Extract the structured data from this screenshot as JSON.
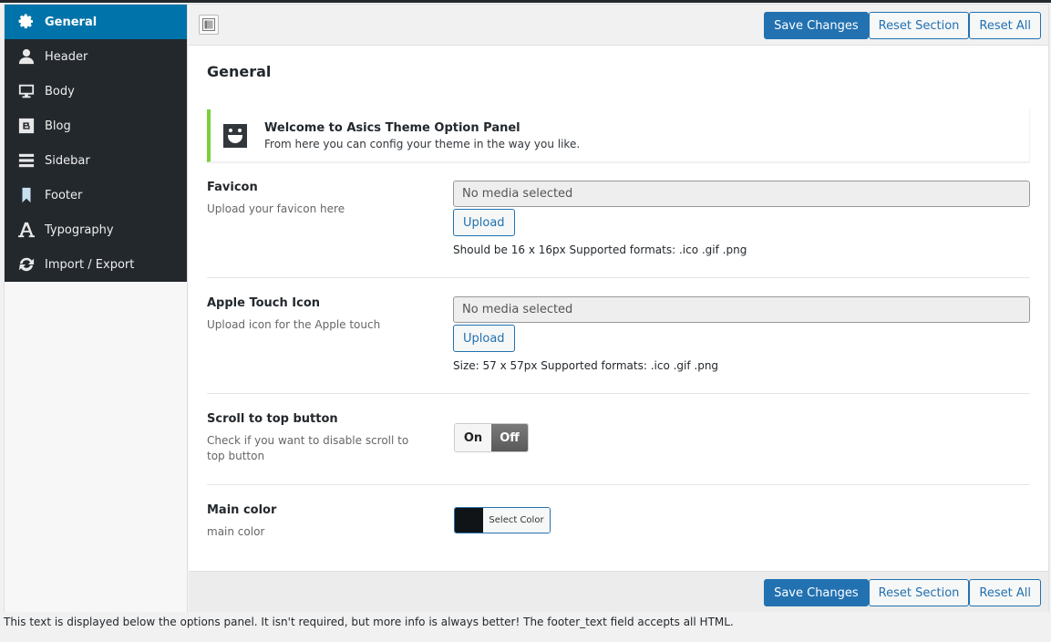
{
  "sidebar": {
    "items": [
      {
        "label": "General",
        "icon": "gear-icon",
        "active": true
      },
      {
        "label": "Header",
        "icon": "user-icon"
      },
      {
        "label": "Body",
        "icon": "monitor-icon"
      },
      {
        "label": "Blog",
        "icon": "blogger-icon"
      },
      {
        "label": "Sidebar",
        "icon": "menu-bars-icon"
      },
      {
        "label": "Footer",
        "icon": "bookmark-icon"
      },
      {
        "label": "Typography",
        "icon": "font-icon"
      },
      {
        "label": "Import / Export",
        "icon": "refresh-icon"
      }
    ]
  },
  "toolbar": {
    "expand_icon": "expand-panel-icon",
    "save_label": "Save Changes",
    "reset_section_label": "Reset Section",
    "reset_all_label": "Reset All"
  },
  "section": {
    "title": "General",
    "notice": {
      "icon": "smiley-icon",
      "title": "Welcome to Asics Theme Option Panel",
      "text": "From here you can config your theme in the way you like.",
      "accent": "#7ad03a"
    },
    "fields": {
      "favicon": {
        "title": "Favicon",
        "desc": "Upload your favicon here",
        "value": "No media selected",
        "button": "Upload",
        "hint": "Should be 16 x 16px Supported formats: .ico .gif .png"
      },
      "apple": {
        "title": "Apple Touch Icon",
        "desc": "Upload icon for the Apple touch",
        "value": "No media selected",
        "button": "Upload",
        "hint": "Size: 57 x 57px Supported formats: .ico .gif .png"
      },
      "scroll": {
        "title": "Scroll to top button",
        "desc": "Check if you want to disable scroll to top button",
        "on_label": "On",
        "off_label": "Off",
        "selected": "Off"
      },
      "color": {
        "title": "Main color",
        "desc": "main color",
        "button": "Select Color",
        "value": "#111417"
      }
    }
  },
  "footer_text": "This text is displayed below the options panel. It isn't required, but more info is always better! The footer_text field accepts all HTML.",
  "colors": {
    "accent": "#0073aa",
    "button": "#2271b1",
    "sidebar_bg": "#23282d"
  }
}
